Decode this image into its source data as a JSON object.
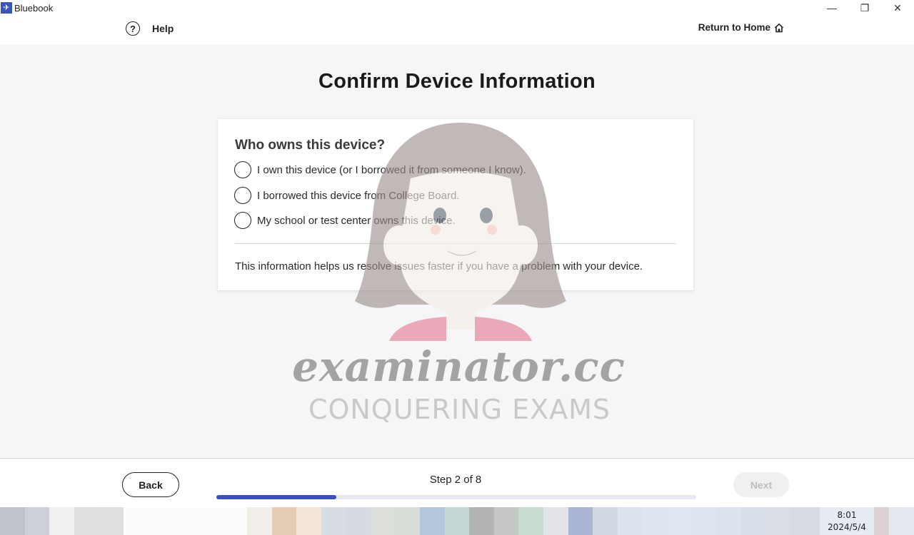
{
  "window": {
    "app_title": "Bluebook",
    "logo_glyph": "✈",
    "controls": [
      {
        "name": "minimize",
        "glyph": "—"
      },
      {
        "name": "restore",
        "glyph": "❐"
      },
      {
        "name": "close",
        "glyph": "✕"
      }
    ]
  },
  "header": {
    "help_icon_glyph": "?",
    "help_label": "Help",
    "return_home_label": "Return to Home",
    "return_home_icon": "home-icon"
  },
  "main": {
    "title": "Confirm Device Information",
    "card": {
      "question": "Who owns this device?",
      "options": [
        {
          "label": "I own this device (or I borrowed it from someone I know).",
          "selected": false
        },
        {
          "label": "I borrowed this device from College Board.",
          "selected": false
        },
        {
          "label": "My school or test center owns this device.",
          "selected": false
        }
      ],
      "info": "This information helps us resolve issues faster if you have a problem with your device."
    },
    "watermark": {
      "main": "examinator.cc",
      "sub": "CONQUERING EXAMS"
    }
  },
  "footer": {
    "back_label": "Back",
    "step_text": "Step 2 of 8",
    "step_current": 2,
    "step_total": 8,
    "progress_fraction": 0.25,
    "next_label": "Next",
    "next_enabled": false,
    "colors": {
      "progress_fill": "#3a4fc2",
      "progress_track": "#e8e9ee"
    }
  },
  "taskbar": {
    "time": "8:01",
    "date": "2024/5/4",
    "blocks": [
      "#bfc3cb",
      "#cdd0d6",
      "#f0f0f0",
      "#dfdfdf",
      "#e0e0e0",
      "#fcfcfc",
      "#fcfcfc",
      "#fcfcfc",
      "#fcfcfc",
      "#fcfcfc",
      "#f1ede9",
      "#e3cdb4",
      "#f4e5d9",
      "#d8dce4",
      "#d6dae2",
      "#dcdeda",
      "#d9ddd8",
      "#b5c7dc",
      "#c6d6d4",
      "#b3b5b2",
      "#c6c8c8",
      "#c7dbd0",
      "#e2e4e8",
      "#aab5d4",
      "#d2d8e4",
      "#dde3ee",
      "#dfe5ef",
      "#e0e6f0",
      "#dfe5ef",
      "#dde3ee",
      "#d9dfea",
      "#d8dde6",
      "#d6dbe4",
      "#d5dae3",
      "#d9dde6",
      "#dcd2d4",
      "#e4e8f0"
    ]
  }
}
